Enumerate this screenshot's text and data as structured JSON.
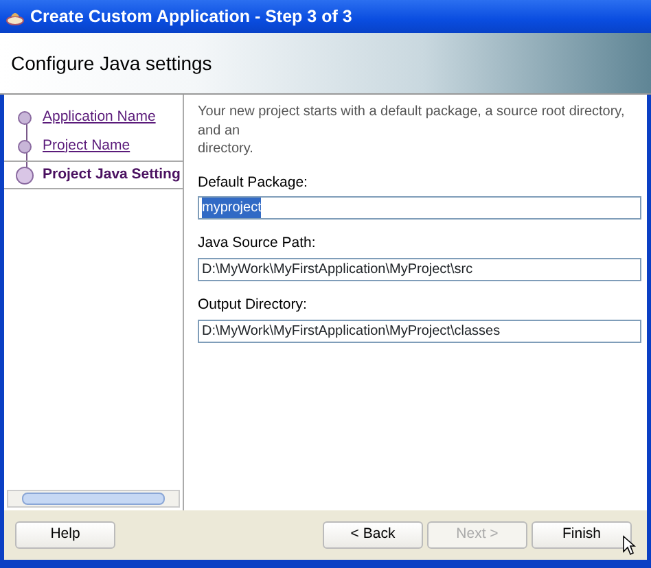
{
  "window": {
    "title": "Create Custom Application - Step 3 of 3"
  },
  "header": {
    "title": "Configure Java settings"
  },
  "steps": [
    {
      "label": "Application Name",
      "selected": false
    },
    {
      "label": "Project Name",
      "selected": false
    },
    {
      "label": "Project Java Setting",
      "selected": true
    }
  ],
  "description": [
    "Your new project starts with a default package, a source root directory, and an",
    "directory."
  ],
  "fields": [
    {
      "label": "Default Package:",
      "value": "myproject",
      "selected": true
    },
    {
      "label": "Java Source Path:",
      "value": "D:\\MyWork\\MyFirstApplication\\MyProject\\src",
      "selected": false
    },
    {
      "label": "Output Directory:",
      "value": "D:\\MyWork\\MyFirstApplication\\MyProject\\classes",
      "selected": false
    }
  ],
  "buttons": [
    {
      "label": "Help",
      "disabled": false
    },
    {
      "label": "< Back",
      "disabled": false
    },
    {
      "label": "Next >",
      "disabled": true
    },
    {
      "label": "Finish",
      "disabled": false
    }
  ]
}
